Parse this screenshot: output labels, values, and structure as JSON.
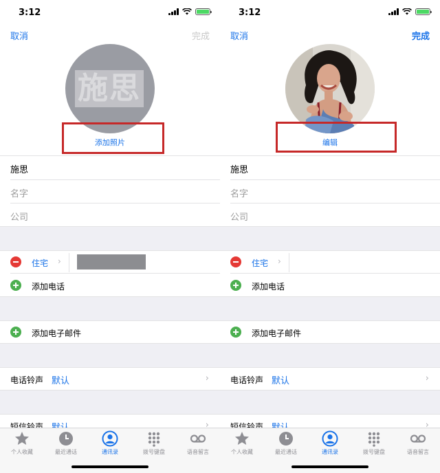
{
  "status_bar": {
    "time": "3:12"
  },
  "nav": {
    "cancel_label": "取消",
    "done_label": "完成"
  },
  "avatar": {
    "initials": "施思"
  },
  "left_screen": {
    "photo_action": "添加照片"
  },
  "right_screen": {
    "photo_action": "编辑"
  },
  "fields": {
    "last_name": "施思",
    "first_name_placeholder": "名字",
    "company_placeholder": "公司"
  },
  "phone": {
    "label": "住宅",
    "add_phone_label": "添加电话"
  },
  "email": {
    "add_email_label": "添加电子邮件"
  },
  "ringtone": {
    "label": "电话铃声",
    "value": "默认"
  },
  "text_tone": {
    "label": "短信铃声",
    "value": "默认"
  },
  "tab_bar": {
    "tabs": [
      {
        "label": "个人收藏",
        "icon": "star-icon"
      },
      {
        "label": "最近通话",
        "icon": "clock-icon"
      },
      {
        "label": "通讯录",
        "icon": "contacts-icon"
      },
      {
        "label": "拨号键盘",
        "icon": "keypad-icon"
      },
      {
        "label": "语音留言",
        "icon": "voicemail-icon"
      }
    ],
    "active_index": 2
  },
  "colors": {
    "accent": "#1a73e8",
    "delete": "#e53935",
    "add": "#4caf50",
    "highlight": "#c62828"
  }
}
